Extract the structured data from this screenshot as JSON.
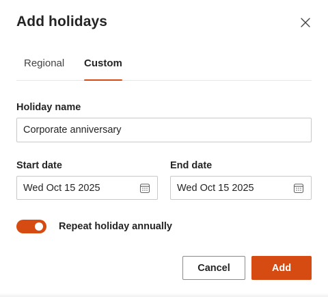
{
  "dialog": {
    "title": "Add holidays",
    "close_icon": "close-icon"
  },
  "tabs": [
    {
      "label": "Regional",
      "selected": false
    },
    {
      "label": "Custom",
      "selected": true
    }
  ],
  "form": {
    "holiday_name": {
      "label": "Holiday name",
      "value": "Corporate anniversary"
    },
    "start_date": {
      "label": "Start date",
      "value": "Wed Oct 15 2025",
      "icon": "calendar-icon"
    },
    "end_date": {
      "label": "End date",
      "value": "Wed Oct 15 2025",
      "icon": "calendar-icon"
    },
    "repeat": {
      "label": "Repeat holiday annually",
      "on": true
    }
  },
  "actions": {
    "cancel_label": "Cancel",
    "add_label": "Add"
  },
  "colors": {
    "accent": "#d64b12",
    "text": "#242424",
    "border": "#c8c8c8"
  }
}
